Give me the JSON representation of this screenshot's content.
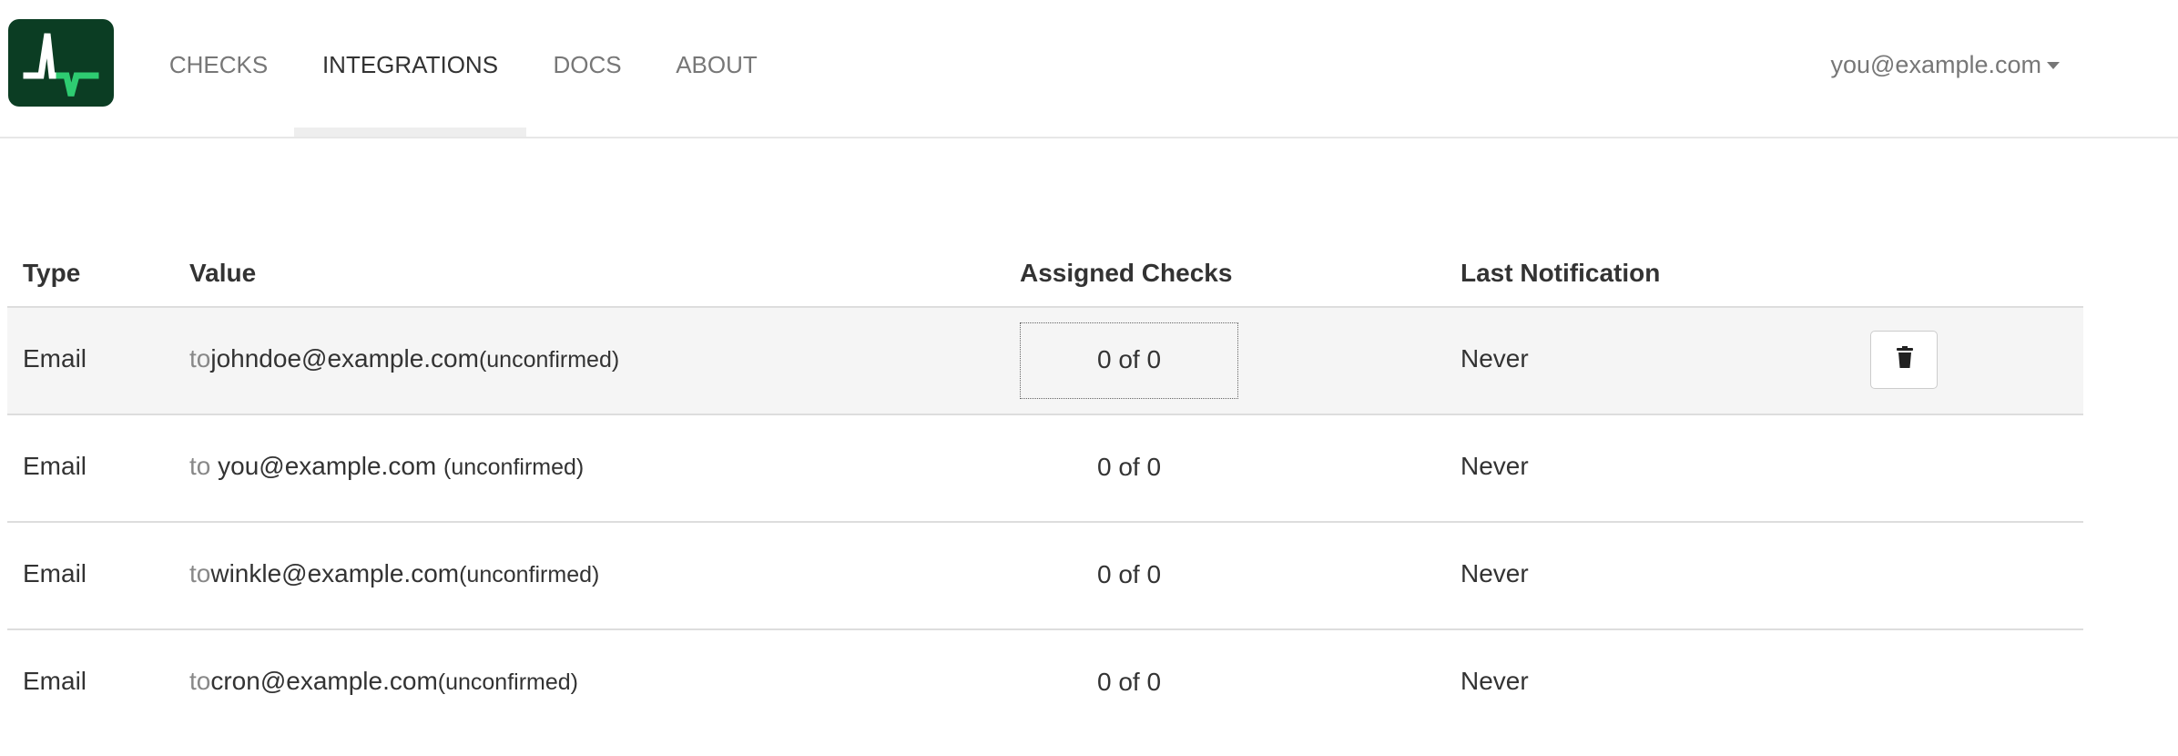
{
  "header": {
    "logo_icon": "pulse-logo-icon",
    "tabs": [
      {
        "label": "CHECKS",
        "active": false
      },
      {
        "label": "INTEGRATIONS",
        "active": true
      },
      {
        "label": "DOCS",
        "active": false
      },
      {
        "label": "ABOUT",
        "active": false
      }
    ],
    "user_email": "you@example.com"
  },
  "table": {
    "columns": [
      "Type",
      "Value",
      "Assigned Checks",
      "Last Notification"
    ],
    "rows": [
      {
        "type": "Email",
        "preposition": "to",
        "value": "johndoe@example.com",
        "status": "(unconfirmed)",
        "assigned": "0 of 0",
        "last": "Never",
        "highlighted": true
      },
      {
        "type": "Email",
        "preposition": "to ",
        "value": "you@example.com ",
        "status": "(unconfirmed)",
        "assigned": "0 of 0",
        "last": "Never",
        "highlighted": false
      },
      {
        "type": "Email",
        "preposition": "to",
        "value": "winkle@example.com",
        "status": "(unconfirmed)",
        "assigned": "0 of 0",
        "last": "Never",
        "highlighted": false
      },
      {
        "type": "Email",
        "preposition": "to",
        "value": "cron@example.com",
        "status": "(unconfirmed)",
        "assigned": "0 of 0",
        "last": "Never",
        "highlighted": false
      }
    ],
    "delete_icon": "trash-icon"
  },
  "colors": {
    "logo_bg": "#0b3d23",
    "logo_accent": "#2ecc71",
    "row_hover": "#f5f5f5",
    "muted_text": "#777777"
  }
}
